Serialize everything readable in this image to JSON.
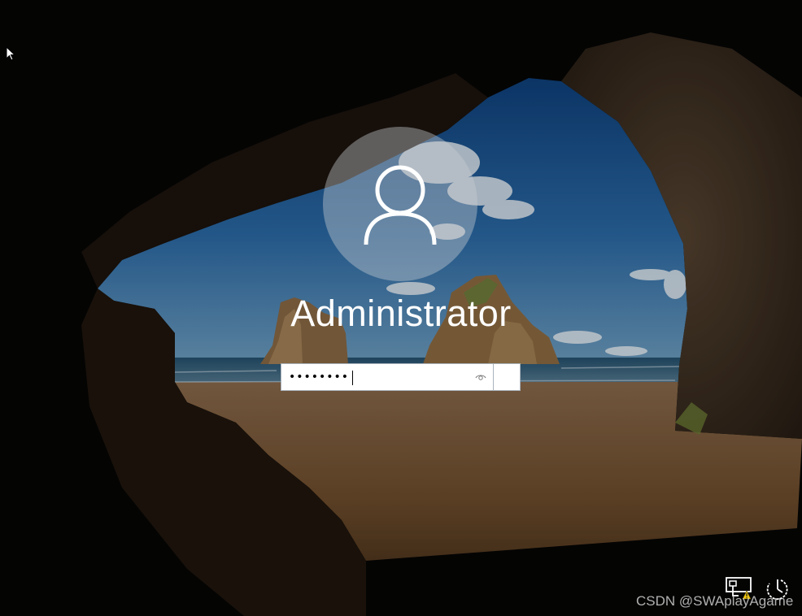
{
  "user": {
    "name": "Administrator"
  },
  "password": {
    "value": "••••••••",
    "masked_length": 8
  },
  "icons": {
    "avatar": "user-icon",
    "reveal": "eye-icon",
    "submit": "arrow-right-icon",
    "network": "network-warning-icon",
    "power": "power-icon",
    "cursor": "mouse-pointer-icon"
  },
  "colors": {
    "text": "#ffffff",
    "input_bg": "#ffffff",
    "input_border": "#a9b2bb",
    "warning": "#f2c811"
  },
  "watermark": {
    "text": "CSDN @SWAplayAgame"
  }
}
